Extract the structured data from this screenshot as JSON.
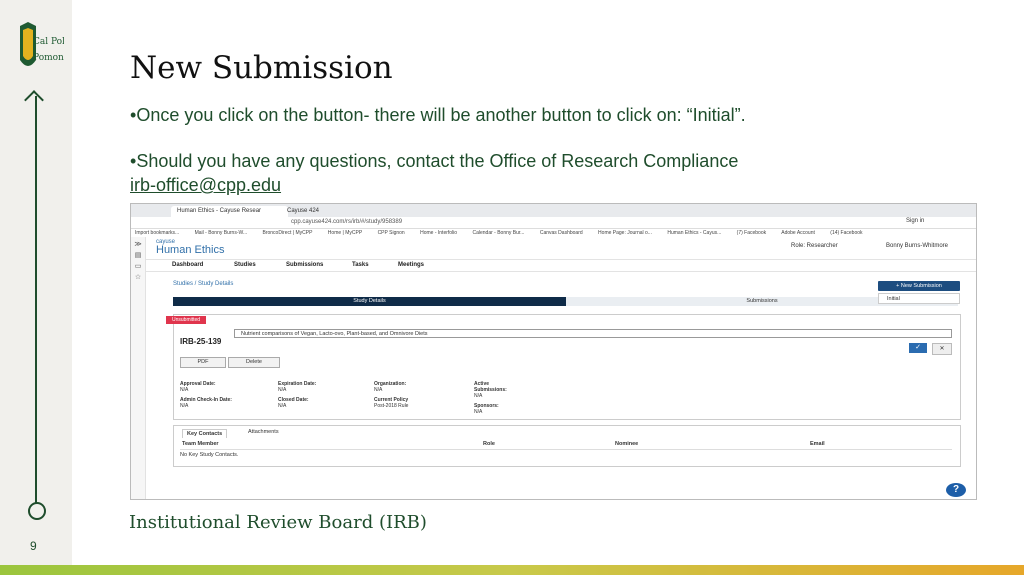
{
  "slide": {
    "title": "New Submission",
    "bullet1": "Once you click on the button- there will be another button to click on:  “Initial”.",
    "bullet2": "Should you have any questions, contact the Office of Research Compliance",
    "email": "irb-office@cpp.edu",
    "footer": "Institutional Review Board (IRB)",
    "page_number": "9",
    "logo_text": "Cal Poly Pomona"
  },
  "browser": {
    "tab_active": "Human Ethics - Cayuse Resear",
    "tab_2": "Cayuse 424",
    "url": "cpp.cayuse424.com/rs/irb/#/study/958389",
    "bookmarks": [
      "Import bookmarks...",
      "Mail - Bonny Burns-W...",
      "BroncoDirect | MyCPP",
      "Home | MyCPP",
      "CPP Signon",
      "Home - Interfolio",
      "Calendar - Bonny Bur...",
      "Canvas Dashboard",
      "Home Page: Journal o...",
      "Human Ethics - Cayus...",
      "(7) Facebook",
      "Adobe Account",
      "(14) Facebook"
    ],
    "sign_in": "Sign in"
  },
  "app": {
    "brand_top": "cayuse",
    "brand_bottom": "Human Ethics",
    "role": "Role:  Researcher",
    "user": "Bonny Burns-Whitmore",
    "nav": [
      "Dashboard",
      "Studies",
      "Submissions",
      "Tasks",
      "Meetings"
    ],
    "breadcrumb": "Studies  /  Study Details",
    "new_submission": "+  New Submission",
    "initial_option": "Initial",
    "tab_study_details": "Study Details",
    "tab_submissions": "Submissions",
    "status_badge": "Unsubmitted",
    "study_title": "Nutrient comparisons of Vegan, Lacto-ovo, Plant-based, and Omnivore Diets",
    "irb_number": "IRB-25-139",
    "pdf_button": "PDF",
    "delete_button": "Delete",
    "ok_glyph": "✓",
    "cancel_glyph": "✕",
    "fields": {
      "approval_date_label": "Approval Date:",
      "approval_date": "N/A",
      "expiration_date_label": "Expiration Date:",
      "expiration_date": "N/A",
      "organization_label": "Organization:",
      "organization": "N/A",
      "active_submissions_label": "Active Submissions:",
      "active_submissions": "N/A",
      "admin_checkin_label": "Admin Check-In Date:",
      "admin_checkin": "N/A",
      "closed_date_label": "Closed Date:",
      "closed_date": "N/A",
      "current_policy_label": "Current Policy",
      "current_policy": "Post-2018 Rule",
      "sponsors_label": "Sponsors:",
      "sponsors": "N/A"
    },
    "contacts_tab": "Key Contacts",
    "attachments_tab": "Attachments",
    "table_headers": [
      "Team Member",
      "Role",
      "Nominee",
      "Email"
    ],
    "empty_row": "No Key Study Contacts.",
    "help": "?"
  }
}
